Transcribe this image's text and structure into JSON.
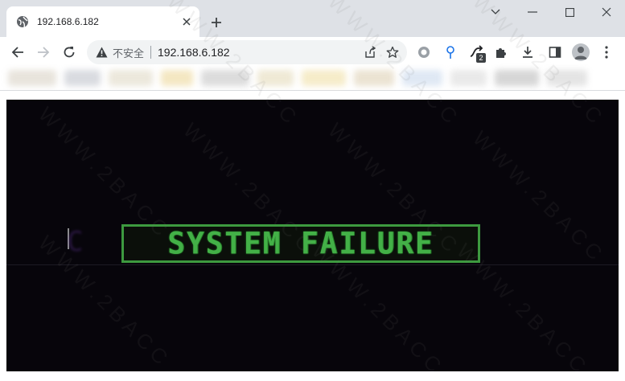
{
  "tab": {
    "title": "192.168.6.182"
  },
  "omnibox": {
    "security_label": "不安全",
    "url": "192.168.6.182"
  },
  "extensions": {
    "badge_count": "2"
  },
  "video": {
    "caption": "SYSTEM FAILURE"
  },
  "watermark": {
    "text": "WWW.2BACC"
  },
  "colors": {
    "failure_green": "#43b047",
    "screen_black": "#07050b",
    "tabstrip": "#dee1e6"
  },
  "icons": [
    "globe-icon",
    "close-icon",
    "plus-icon",
    "minimize-icon",
    "maximize-icon",
    "window-close-icon",
    "chevron-down-icon",
    "back-arrow-icon",
    "forward-arrow-icon",
    "reload-icon",
    "warning-icon",
    "share-icon",
    "star-icon",
    "circle-extension-icon",
    "pin-extension-icon",
    "route-extension-icon",
    "puzzle-icon",
    "download-icon",
    "side-panel-icon",
    "profile-icon",
    "more-vert-icon"
  ]
}
